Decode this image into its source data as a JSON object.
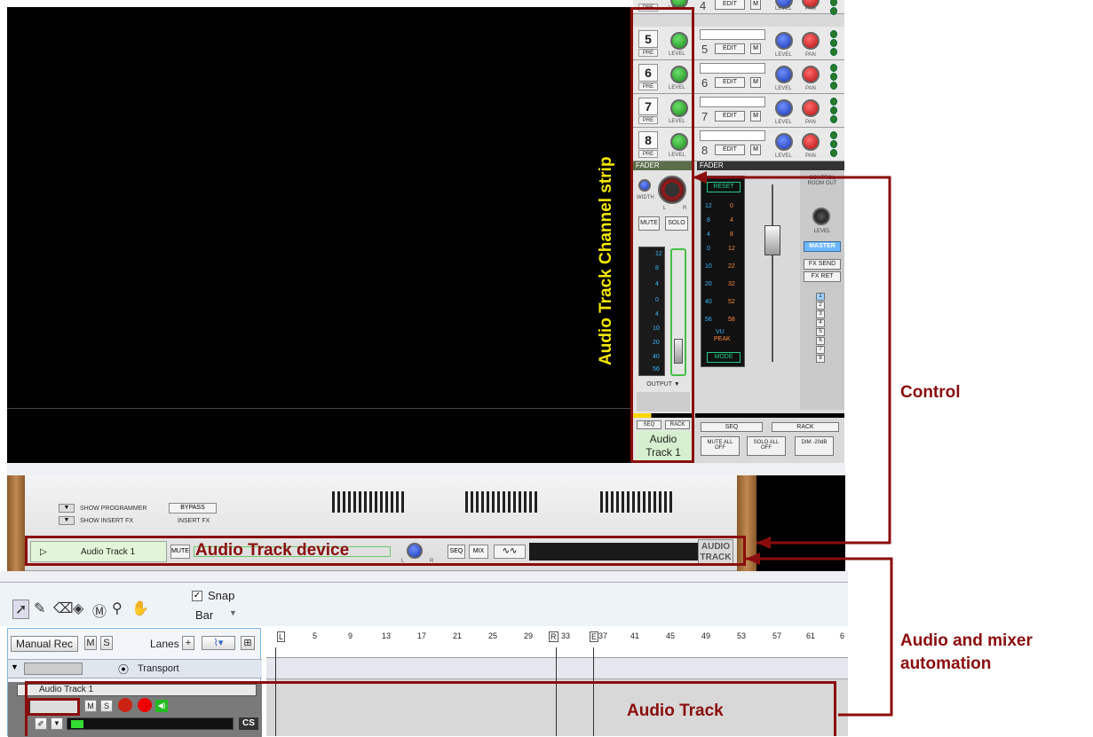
{
  "mixer": {
    "rows": [
      {
        "num": "4",
        "pre": "PRE"
      },
      {
        "num": "5",
        "pre": "PRE"
      },
      {
        "num": "6",
        "pre": "PRE"
      },
      {
        "num": "7",
        "pre": "PRE"
      },
      {
        "num": "8",
        "pre": "PRE"
      }
    ],
    "level_label": "LEVEL",
    "pan_label": "PAN",
    "edit_label": "EDIT",
    "m_label": "M",
    "fader_label": "FADER",
    "width_label": "WIDTH",
    "l_label": "L",
    "r_label": "R",
    "mute_label": "MUTE",
    "solo_label": "SOLO",
    "output_label": "OUTPUT",
    "reset_label": "RESET",
    "vu_label": "VU",
    "peak_label": "PEAK",
    "mode_label": "MODE",
    "control_room_label": "CONTROL ROOM OUT",
    "master_label": "MASTER",
    "fx_send_label": "FX SEND",
    "fx_ret_label": "FX RET",
    "fx_numbers": [
      "1",
      "2",
      "3",
      "4",
      "5",
      "6",
      "7",
      "8"
    ],
    "seq_label": "SEQ",
    "rack_label": "RACK",
    "mute_all_label": "MUTE ALL OFF",
    "solo_all_label": "SOLO ALL OFF",
    "dim_label": "DIM -20dB",
    "channel_name_line1": "Audio",
    "channel_name_line2": "Track 1",
    "meter_left": [
      "12",
      "8",
      "4",
      "0",
      "4",
      "10",
      "20",
      "40",
      "56"
    ],
    "meter_right": [
      "12",
      "8",
      "4",
      "0",
      "10",
      "20",
      "40",
      "56"
    ],
    "big_meter_left": [
      "12",
      "8",
      "4",
      "0",
      "10",
      "20",
      "40",
      "56"
    ],
    "big_meter_right": [
      "0",
      "4",
      "8",
      "12",
      "22",
      "32",
      "52",
      "58"
    ]
  },
  "device": {
    "show_programmer": "SHOW PROGRAMMER",
    "show_insert_fx": "SHOW INSERT FX",
    "bypass": "BYPASS",
    "insert_fx": "INSERT FX",
    "track_name": "Audio Track 1",
    "mute": "MUTE",
    "seq": "SEQ",
    "mix": "MIX",
    "l": "L",
    "r": "R",
    "brand_line1": "AUDIO",
    "brand_line2": "TRACK"
  },
  "toolbar": {
    "snap_label": "Snap",
    "snap_value": "Bar"
  },
  "sequencer": {
    "manual_rec": "Manual Rec",
    "m": "M",
    "s": "S",
    "lanes": "Lanes",
    "transport": "Transport",
    "track_name": "Audio Track 1",
    "cs": "CS",
    "ruler": [
      "5",
      "9",
      "13",
      "17",
      "21",
      "25",
      "29",
      "33",
      "37",
      "41",
      "45",
      "49",
      "53",
      "57",
      "61",
      "6"
    ],
    "marker_l": "L",
    "marker_r": "R",
    "marker_e": "E"
  },
  "annotations": {
    "channel_strip": "Audio Track Channel strip",
    "control": "Control",
    "device": "Audio Track device",
    "automation_line1": "Audio and mixer",
    "automation_line2": "automation",
    "audio_track": "Audio Track"
  },
  "colors": {
    "annotation_red": "#8b0d0d",
    "annotation_yellow": "#f4e800"
  }
}
